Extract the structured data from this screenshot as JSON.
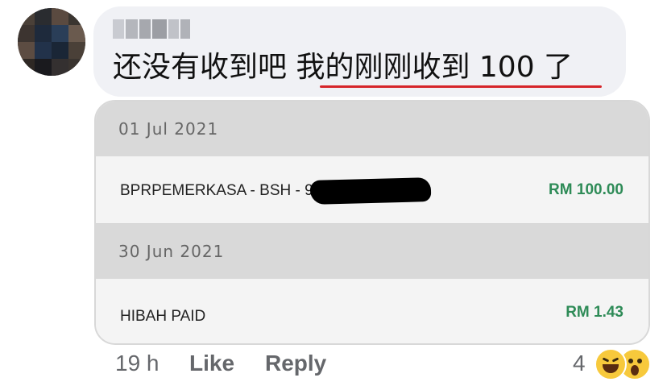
{
  "comment": {
    "author_name_redacted": "",
    "text_plain": "还没有收到吧 ",
    "text_underlined": "我的刚刚收到 100 了"
  },
  "attachment": {
    "transactions": [
      {
        "date": "01 Jul 2021",
        "description": "BPRPEMERKASA - BSH - 9",
        "amount": "RM 100.00"
      },
      {
        "date": "30 Jun 2021",
        "description": "HIBAH PAID",
        "amount": "RM 1.43"
      }
    ]
  },
  "footer": {
    "time": "19 h",
    "like_label": "Like",
    "reply_label": "Reply",
    "reaction_count": "4",
    "reactions": [
      "haha-icon",
      "wow-icon"
    ]
  },
  "colors": {
    "bubble_bg": "#f0f1f5",
    "underline": "#d6252a",
    "amount": "#2e8b57",
    "meta_text": "#65676b"
  }
}
